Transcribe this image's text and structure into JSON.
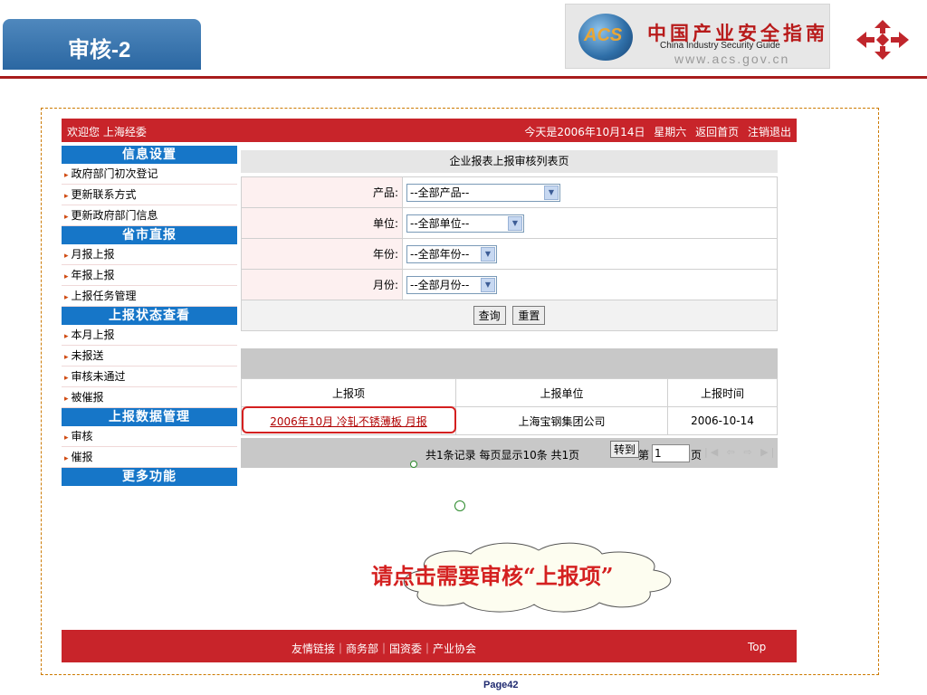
{
  "slide": {
    "title": "审核-2",
    "page": "Page42"
  },
  "logo": {
    "badge": "ACS",
    "cn": "中国产业安全指南",
    "en": "China   Industry   Security   Guide",
    "url": "www.acs.gov.cn"
  },
  "topbar": {
    "welcome": "欢迎您 上海经委",
    "date": "今天是2006年10月14日",
    "weekday": "星期六",
    "home": "返回首页",
    "logout": "注销退出"
  },
  "sidebar": {
    "sections": [
      {
        "title": "信息设置",
        "items": [
          "政府部门初次登记",
          "更新联系方式",
          "更新政府部门信息"
        ]
      },
      {
        "title": "省市直报",
        "items": [
          "月报上报",
          "年报上报",
          "上报任务管理"
        ]
      },
      {
        "title": "上报状态查看",
        "items": [
          "本月上报",
          "未报送",
          "审核未通过",
          "被催报"
        ]
      },
      {
        "title": "上报数据管理",
        "items": [
          "审核",
          "催报"
        ]
      },
      {
        "title": "更多功能",
        "items": []
      }
    ]
  },
  "form": {
    "caption": "企业报表上报审核列表页",
    "fields": [
      {
        "label": "产品:",
        "value": "--全部产品--"
      },
      {
        "label": "单位:",
        "value": "--全部单位--"
      },
      {
        "label": "年份:",
        "value": "--全部年份--"
      },
      {
        "label": "月份:",
        "value": "--全部月份--"
      }
    ],
    "query_label": "查询",
    "reset_label": "重置"
  },
  "results": {
    "headers": [
      "上报项",
      "上报单位",
      "上报时间"
    ],
    "rows": [
      {
        "item": "2006年10月 冷轧不锈薄板 月报",
        "unit": "上海宝钢集团公司",
        "time": "2006-10-14"
      }
    ]
  },
  "pager": {
    "summary": "共1条记录   每页显示10条   共1页",
    "goto_label": "转到",
    "page_prefix": "第",
    "page_value": "1",
    "page_suffix": "页",
    "nav_icons": [
      "first-page-icon",
      "prev-page-icon",
      "next-page-icon",
      "last-page-icon"
    ]
  },
  "footer": {
    "links": "友情链接｜商务部｜国资委｜产业协会",
    "top": "Top"
  },
  "callout": {
    "text": "请点击需要审核“上报项”"
  },
  "colors": {
    "brand_red": "#c8242a",
    "sidebar_blue": "#1676c8",
    "title_blue": "#2b67a2",
    "highlight_red": "#d42020"
  }
}
